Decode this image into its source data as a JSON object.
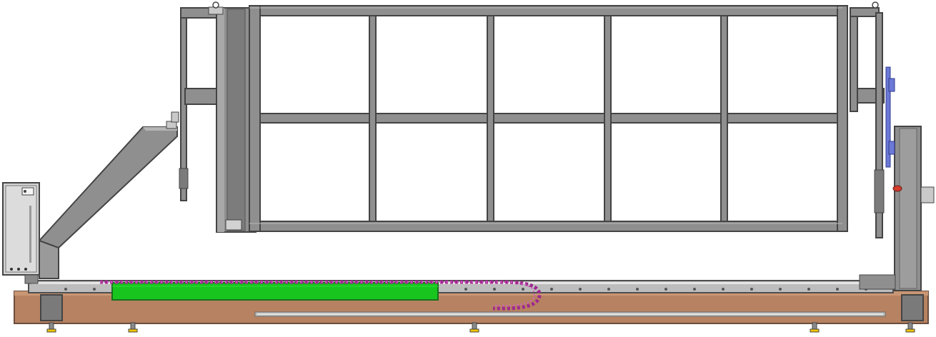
{
  "drawing": {
    "kind": "mechanical-side-elevation",
    "colors": {
      "background": "#ffffff",
      "steel": "#8f8f8f",
      "steel_dark": "#6f6f6f",
      "steel_light": "#b9b9b9",
      "outline": "#3f3f3f",
      "base_wood": "#b78261",
      "base_dark": "#8f5f45",
      "green_rail": "#18c51f",
      "cable_chain": "#a0288f",
      "cabinet": "#d2d2d2",
      "blue_component": "#6b78d6",
      "red_component": "#d23b2a",
      "feet": "#f2c400"
    },
    "icons": {
      "electrical_cabinet": "control-cabinet-icon",
      "cable_chain": "cable-carrier-icon",
      "feet": "leveling-foot-icon"
    }
  }
}
